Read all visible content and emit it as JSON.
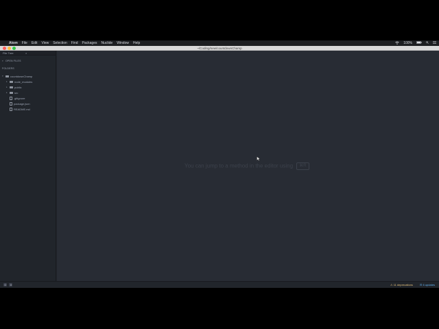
{
  "menubar": {
    "apple": "",
    "app": "Atom",
    "items": [
      "File",
      "Edit",
      "View",
      "Selection",
      "Find",
      "Packages",
      "Nuclide",
      "Window",
      "Help"
    ],
    "battery": "100%"
  },
  "window": {
    "title": "~/Coding/new/countdownChamp"
  },
  "sidebar": {
    "tab_title": "File Tree",
    "tab_close": "×",
    "open_files_label": "OPEN FILES",
    "folders_label": "FOLDERS",
    "root": "countdownChamp",
    "folders": [
      "node_modules",
      "public",
      "src"
    ],
    "files": [
      ".gitignore",
      "package.json",
      "README.md"
    ]
  },
  "editor": {
    "hint": "You can jump to a method in the editor using",
    "shortcut": "⌘R"
  },
  "statusbar": {
    "left_badges": [
      "0",
      "0"
    ],
    "deprecations": "11 deprecations",
    "updates": "6 updates"
  },
  "colors": {
    "close": "#fc605c",
    "minimize": "#fdbc40",
    "maximize": "#34c84a",
    "warning": "#e5c07b",
    "info": "#61afef"
  }
}
